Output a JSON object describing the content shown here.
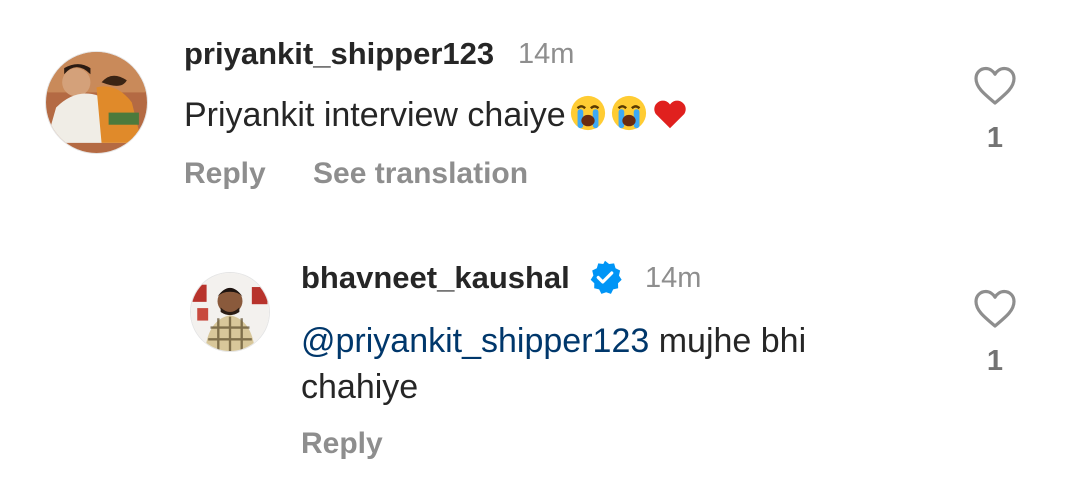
{
  "comments": [
    {
      "username": "priyankit_shipper123",
      "time": "14m",
      "text": "Priyankit interview chaiye",
      "emojis": [
        "loudly-crying-face",
        "loudly-crying-face",
        "red-heart"
      ],
      "actions": {
        "reply": "Reply",
        "translate": "See translation"
      },
      "likes": "1",
      "avatar_icon": "avatar-couple-hug"
    },
    {
      "username": "bhavneet_kaushal",
      "verified": true,
      "time": "14m",
      "mention": "@priyankit_shipper123",
      "text_line1": " mujhe bhi",
      "text_line2": "chahiye",
      "actions": {
        "reply": "Reply"
      },
      "likes": "1",
      "avatar_icon": "avatar-man-plaid-shirt"
    }
  ],
  "colors": {
    "text": "#262626",
    "secondary": "#8e8e8e",
    "mention": "#00376b",
    "verified": "#0095f6",
    "heart_outline": "#8e8e8e"
  }
}
